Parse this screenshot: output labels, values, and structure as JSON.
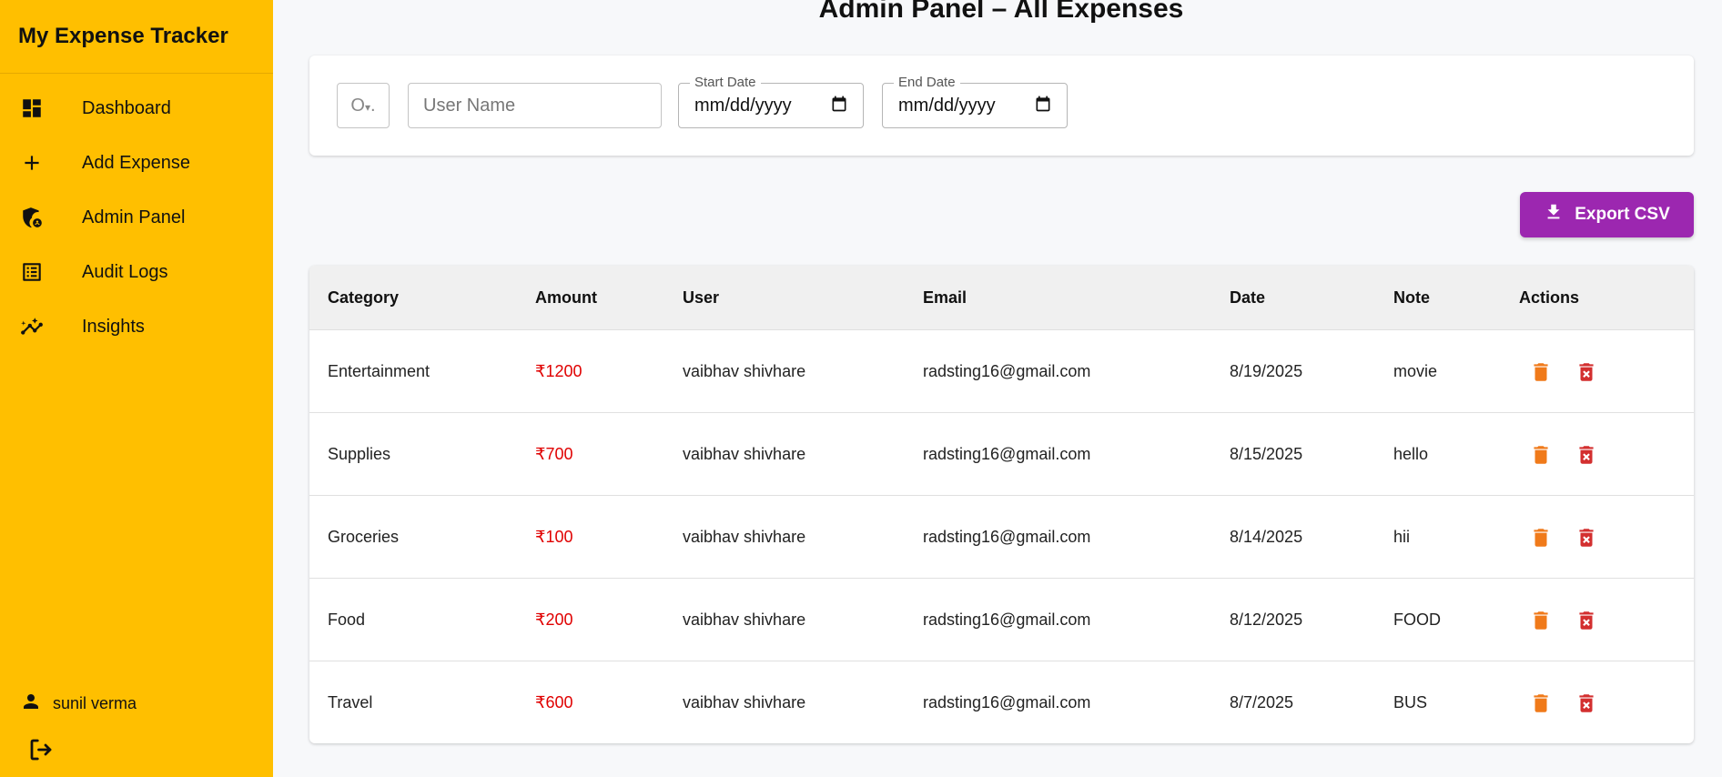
{
  "app": {
    "title": "My Expense Tracker"
  },
  "sidebar": {
    "items": [
      {
        "label": "Dashboard",
        "icon": "dashboard-icon"
      },
      {
        "label": "Add Expense",
        "icon": "plus-icon"
      },
      {
        "label": "Admin Panel",
        "icon": "admin-shield-icon"
      },
      {
        "label": "Audit Logs",
        "icon": "list-icon"
      },
      {
        "label": "Insights",
        "icon": "insights-icon"
      }
    ],
    "user": {
      "name": "sunil verma"
    }
  },
  "main": {
    "title": "Admin Panel – All Expenses",
    "filters": {
      "user_name_placeholder": "User Name",
      "start_date_label": "Start Date",
      "start_date_value": "mm/dd/yyyy",
      "end_date_label": "End Date",
      "end_date_value": "mm/dd/yyyy"
    },
    "export_label": "Export CSV",
    "table": {
      "columns": [
        "Category",
        "Amount",
        "User",
        "Email",
        "Date",
        "Note",
        "Actions"
      ],
      "rows": [
        {
          "category": "Entertainment",
          "amount": "₹1200",
          "user": "vaibhav shivhare",
          "email": "radsting16@gmail.com",
          "date": "8/19/2025",
          "note": "movie"
        },
        {
          "category": "Supplies",
          "amount": "₹700",
          "user": "vaibhav shivhare",
          "email": "radsting16@gmail.com",
          "date": "8/15/2025",
          "note": "hello"
        },
        {
          "category": "Groceries",
          "amount": "₹100",
          "user": "vaibhav shivhare",
          "email": "radsting16@gmail.com",
          "date": "8/14/2025",
          "note": "hii"
        },
        {
          "category": "Food",
          "amount": "₹200",
          "user": "vaibhav shivhare",
          "email": "radsting16@gmail.com",
          "date": "8/12/2025",
          "note": "FOOD"
        },
        {
          "category": "Travel",
          "amount": "₹600",
          "user": "vaibhav shivhare",
          "email": "radsting16@gmail.com",
          "date": "8/7/2025",
          "note": "BUS"
        }
      ]
    }
  },
  "colors": {
    "sidebar_bg": "#ffbf00",
    "export_button": "#9c27b0",
    "amount_text": "#e00000",
    "delete_icon": "#f07a1a",
    "delete_forever_icon": "#d32f2f"
  }
}
